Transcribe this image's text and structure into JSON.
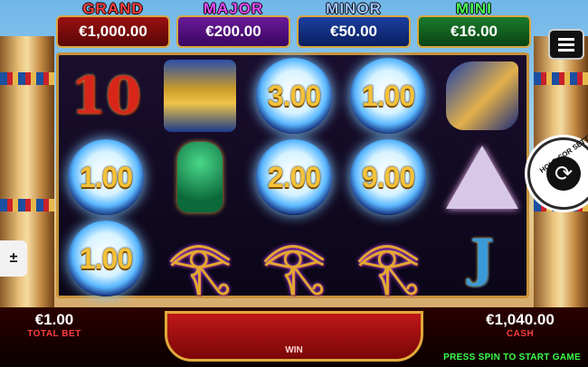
{
  "jackpots": [
    {
      "name": "GRAND",
      "value": "€1,000.00"
    },
    {
      "name": "MAJOR",
      "value": "€200.00"
    },
    {
      "name": "MINOR",
      "value": "€50.00"
    },
    {
      "name": "MINI",
      "value": "€16.00"
    }
  ],
  "grid": {
    "rows": [
      [
        {
          "kind": "symbol",
          "icon": "ten-symbol-icon",
          "text": "10"
        },
        {
          "kind": "symbol",
          "icon": "pharaoh-symbol-icon"
        },
        {
          "kind": "coin",
          "text": "3.00"
        },
        {
          "kind": "coin",
          "text": "1.00"
        },
        {
          "kind": "symbol",
          "icon": "anubis-symbol-icon"
        }
      ],
      [
        {
          "kind": "coin",
          "text": "1.00"
        },
        {
          "kind": "symbol",
          "icon": "cat-symbol-icon"
        },
        {
          "kind": "coin",
          "text": "2.00"
        },
        {
          "kind": "coin",
          "text": "9.00"
        },
        {
          "kind": "symbol",
          "icon": "pyramid-symbol-icon"
        }
      ],
      [
        {
          "kind": "coin",
          "text": "1.00"
        },
        {
          "kind": "symbol",
          "icon": "eye-of-horus-symbol-icon"
        },
        {
          "kind": "symbol",
          "icon": "eye-of-horus-symbol-icon"
        },
        {
          "kind": "symbol",
          "icon": "eye-of-horus-symbol-icon"
        },
        {
          "kind": "symbol",
          "icon": "jack-symbol-icon",
          "text": "J"
        }
      ]
    ]
  },
  "hold_button": {
    "label": "HOLD FOR SETTINGS",
    "icon": "spin-arrows-icon"
  },
  "bet_tab": {
    "label": "±"
  },
  "footer": {
    "total_bet_value": "€1.00",
    "total_bet_label": "TOTAL BET",
    "win_label": "WIN",
    "cash_value": "€1,040.00",
    "cash_label": "CASH",
    "prompt": "PRESS SPIN TO START GAME"
  },
  "icons": {
    "menu": "hamburger-menu-icon"
  },
  "colors": {
    "grand": "#ff4040",
    "major": "#e64cff",
    "minor": "#9fc2ff",
    "mini": "#4cff5a",
    "coin_text": "#f4c23a",
    "prompt": "#39ff4a"
  }
}
